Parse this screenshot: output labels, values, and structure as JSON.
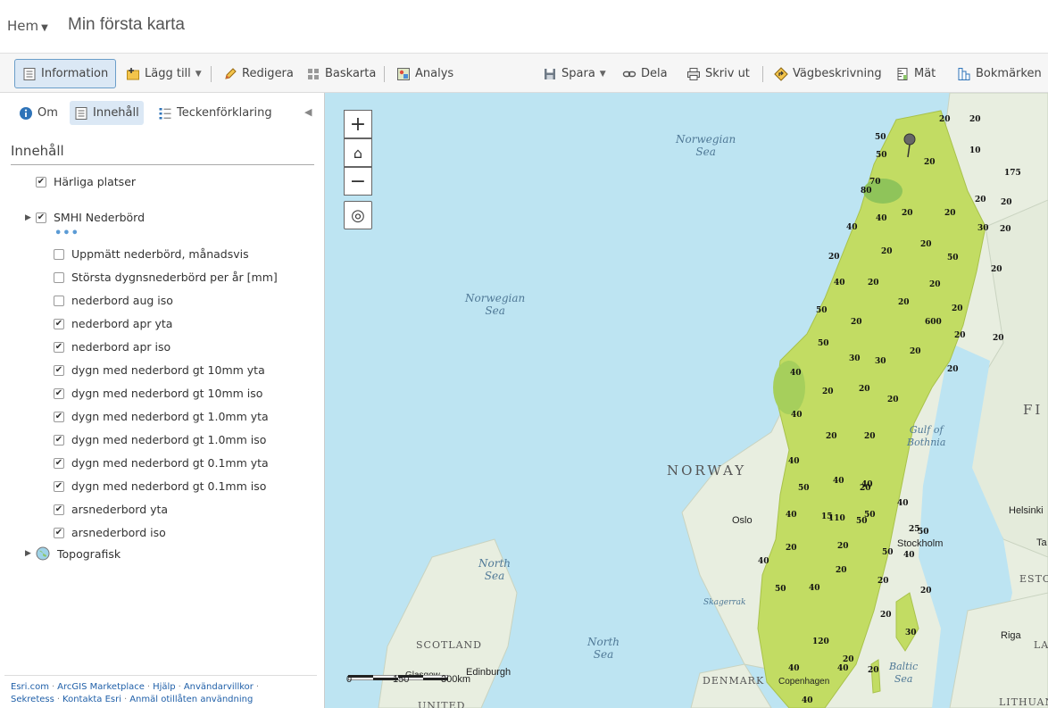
{
  "header": {
    "home": "Hem",
    "title": "Min första karta"
  },
  "toolbar": {
    "information": "Information",
    "add": "Lägg till",
    "edit": "Redigera",
    "basemap": "Baskarta",
    "analysis": "Analys",
    "save": "Spara",
    "share": "Dela",
    "print": "Skriv ut",
    "directions": "Vägbeskrivning",
    "measure": "Mät",
    "bookmarks": "Bokmärken"
  },
  "panel": {
    "tabs": {
      "about": "Om",
      "content": "Innehåll",
      "legend": "Teckenförklaring"
    },
    "heading": "Innehåll",
    "more": "•••",
    "layers": [
      {
        "label": "Härliga platser",
        "checked": true
      },
      {
        "label": "SMHI Nederbörd",
        "checked": true
      },
      {
        "label": "Uppmätt nederbörd, månadsvis",
        "checked": false
      },
      {
        "label": "Största dygnsnederbörd per år [mm]",
        "checked": false
      },
      {
        "label": "nederbord aug iso",
        "checked": false
      },
      {
        "label": "nederbord apr yta",
        "checked": true
      },
      {
        "label": "nederbord apr iso",
        "checked": true
      },
      {
        "label": "dygn med nederbord gt 10mm yta",
        "checked": true
      },
      {
        "label": "dygn med nederbord gt 10mm iso",
        "checked": true
      },
      {
        "label": "dygn med nederbord gt 1.0mm yta",
        "checked": true
      },
      {
        "label": "dygn med nederbord gt 1.0mm iso",
        "checked": true
      },
      {
        "label": "dygn med nederbord gt 0.1mm yta",
        "checked": true
      },
      {
        "label": "dygn med nederbord gt 0.1mm iso",
        "checked": true
      },
      {
        "label": "arsnederbord yta",
        "checked": true
      },
      {
        "label": "arsnederbord iso",
        "checked": true
      },
      {
        "label": "Topografisk",
        "checked": null
      }
    ],
    "footer": {
      "esri": "Esri.com",
      "marketplace": "ArcGIS Marketplace",
      "help": "Hjälp",
      "terms": "Användarvillkor",
      "privacy": "Sekretess",
      "contact": "Kontakta Esri",
      "report": "Anmäl otillåten användning"
    }
  },
  "map": {
    "seas": {
      "norwegian_1": "Norwegian\nSea",
      "norwegian_2": "Norwegian\nSea",
      "north_1": "North\nSea",
      "north_2": "North\nSea",
      "gulf": "Gulf of\nBothnia",
      "baltic": "Baltic\nSea",
      "skagerrak": "Skagerrak"
    },
    "countries": {
      "norway": "NORWAY",
      "scotland": "SCOTLAND",
      "denmark": "DENMARK",
      "lithuania": "LITHUANIA",
      "finland": "FI",
      "estonia": "ESTO",
      "latvia": "LA",
      "united": "UNITED"
    },
    "cities": {
      "oslo": "Oslo",
      "stockholm": "Stockholm",
      "helsinki": "Helsinki",
      "riga": "Riga",
      "edinburgh": "Edinburgh",
      "glasgow": "Glasgow",
      "copenhagen": "Copenhagen",
      "tallinn": "Ta"
    },
    "scale": {
      "zero": "0",
      "mid": "150",
      "end": "300km"
    },
    "precip_labels": [
      "20",
      "20",
      "50",
      "10",
      "50",
      "20",
      "175",
      "70",
      "80",
      "40",
      "20",
      "20",
      "20",
      "20",
      "40",
      "30",
      "20",
      "20",
      "20",
      "50",
      "20",
      "20",
      "40",
      "20",
      "20",
      "20",
      "20",
      "50",
      "20",
      "600",
      "20",
      "20",
      "50",
      "30",
      "30",
      "20",
      "20",
      "40",
      "20",
      "20",
      "20",
      "40",
      "20",
      "20",
      "40",
      "40",
      "50",
      "40",
      "110",
      "20",
      "40",
      "50",
      "50",
      "40",
      "15",
      "25",
      "50",
      "40",
      "20",
      "20",
      "50",
      "40",
      "20",
      "20",
      "20",
      "50",
      "40",
      "20",
      "30",
      "120",
      "20",
      "40",
      "40",
      "20",
      "40"
    ],
    "zoom_in": "+",
    "zoom_out": "−"
  }
}
